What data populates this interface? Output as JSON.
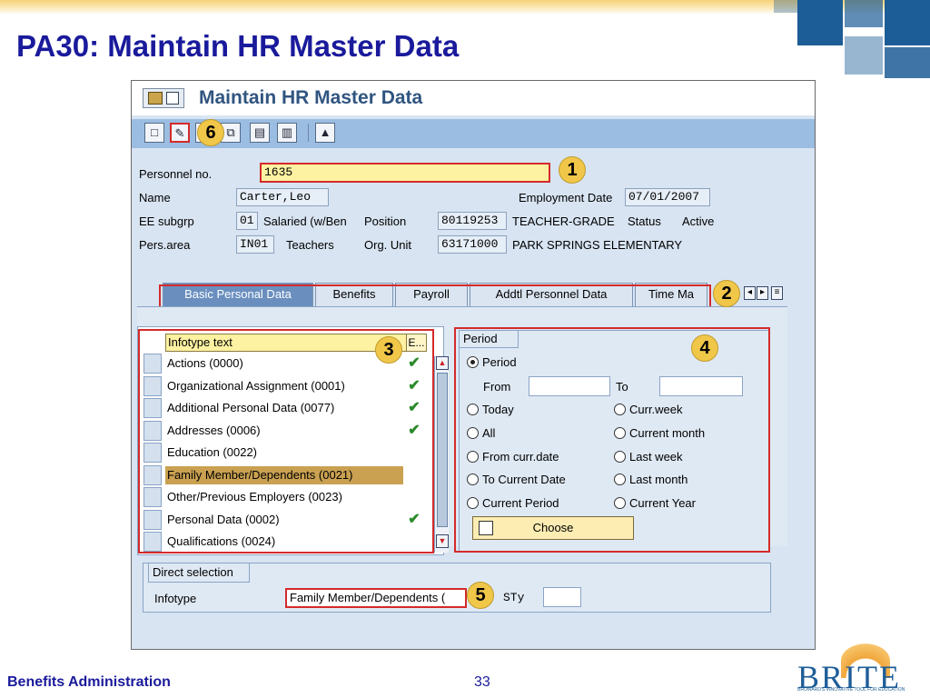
{
  "slide": {
    "title": "PA30: Maintain HR Master Data",
    "footer_left": "Benefits Administration",
    "page_number": "33",
    "logo_text": "BRITE",
    "logo_tagline": "BROWARD'S INNOVATIVE TOOL FOR EDUCATION"
  },
  "window": {
    "title": "Maintain HR Master Data"
  },
  "toolbar": {
    "buttons": [
      "create-icon",
      "change-icon",
      "display-icon",
      "copy-icon",
      "delimit-icon",
      "delete-icon",
      "overview-icon"
    ]
  },
  "header": {
    "personnel_no_label": "Personnel no.",
    "personnel_no_value": "1635",
    "name_label": "Name",
    "name_value": "Carter,Leo",
    "employment_date_label": "Employment Date",
    "employment_date_value": "07/01/2007",
    "ee_subgrp_label": "EE subgrp",
    "ee_subgrp_code": "01",
    "ee_subgrp_text": "Salaried (w/Ben",
    "position_label": "Position",
    "position_code": "80119253",
    "position_text": "TEACHER-GRADE",
    "status_label": "Status",
    "status_value": "Active",
    "pers_area_label": "Pers.area",
    "pers_area_code": "IN01",
    "pers_area_text": "Teachers",
    "org_unit_label": "Org. Unit",
    "org_unit_code": "63171000",
    "org_unit_text": "PARK SPRINGS ELEMENTARY"
  },
  "tabs": [
    "Basic Personal Data",
    "Benefits",
    "Payroll",
    "Addtl Personnel Data",
    "Time Ma"
  ],
  "infotypes": {
    "header_text": "Infotype text",
    "header_e": "E...",
    "rows": [
      {
        "text": "Actions (0000)",
        "check": "✔"
      },
      {
        "text": "Organizational Assignment (0001)",
        "check": "✔"
      },
      {
        "text": "Additional Personal Data (0077)",
        "check": "✔"
      },
      {
        "text": "Addresses (0006)",
        "check": "✔"
      },
      {
        "text": "Education (0022)",
        "check": ""
      },
      {
        "text": "Family Member/Dependents (0021)",
        "check": ""
      },
      {
        "text": "Other/Previous Employers (0023)",
        "check": ""
      },
      {
        "text": "Personal Data (0002)",
        "check": "✔"
      },
      {
        "text": "Qualifications (0024)",
        "check": ""
      }
    ]
  },
  "period": {
    "group_label": "Period",
    "period_option": "Period",
    "from_label": "From",
    "to_label": "To",
    "options_left": [
      "Today",
      "All",
      "From curr.date",
      "To Current Date",
      "Current Period"
    ],
    "options_right": [
      "Curr.week",
      "Current month",
      "Last week",
      "Last month",
      "Current Year"
    ],
    "choose_label": "Choose"
  },
  "direct_selection": {
    "group_label": "Direct selection",
    "infotype_label": "Infotype",
    "infotype_value": "Family Member/Dependents (",
    "sty_label": "STy"
  },
  "callouts": [
    "1",
    "2",
    "3",
    "4",
    "5",
    "6"
  ]
}
